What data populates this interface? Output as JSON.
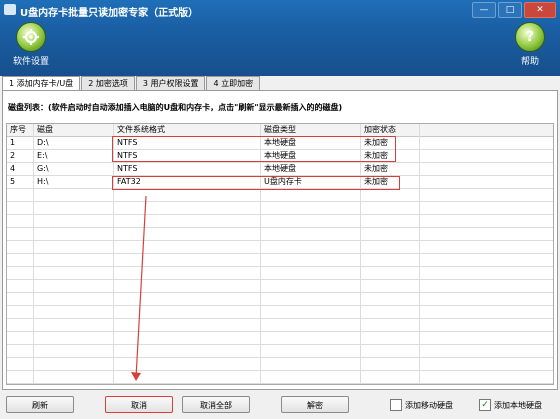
{
  "window": {
    "title": "U盘内存卡批量只读加密专家（正式版）",
    "controls": [
      "—",
      "□",
      "✕"
    ]
  },
  "toolbar": {
    "settings_label": "软件设置",
    "help_label": "帮助",
    "help_glyph": "?"
  },
  "tabs": [
    {
      "label": "1 添加内存卡/U盘",
      "active": true
    },
    {
      "label": "2 加密选项",
      "active": false
    },
    {
      "label": "3 用户权限设置",
      "active": false
    },
    {
      "label": "4 立即加密",
      "active": false
    }
  ],
  "disk_list_title": "磁盘列表：(软件启动时自动添加插入电脑的U盘和内存卡，点击\"刷新\"显示最新插入的的磁盘)",
  "table": {
    "columns": [
      "序号",
      "磁盘",
      "文件系统格式",
      "磁盘类型",
      "加密状态"
    ],
    "rows": [
      [
        "1",
        "D:\\",
        "NTFS",
        "本地硬盘",
        "未加密"
      ],
      [
        "2",
        "E:\\",
        "NTFS",
        "本地硬盘",
        "未加密"
      ],
      [
        "4",
        "G:\\",
        "NTFS",
        "本地硬盘",
        "未加密"
      ],
      [
        "5",
        "H:\\",
        "FAT32",
        "U盘内存卡",
        "未加密"
      ]
    ]
  },
  "buttons": {
    "refresh": "刷新",
    "cancel": "取消",
    "cancel_all": "取消全部",
    "decrypt": "解密"
  },
  "checkboxes": {
    "add_removable": {
      "label": "添加移动硬盘",
      "checked": false
    },
    "add_local": {
      "label": "添加本地硬盘",
      "checked": true
    }
  },
  "colors": {
    "title_bar": "#1a5ea3",
    "annotation_red": "#d6403b",
    "icon_green": "#8fc73e"
  }
}
